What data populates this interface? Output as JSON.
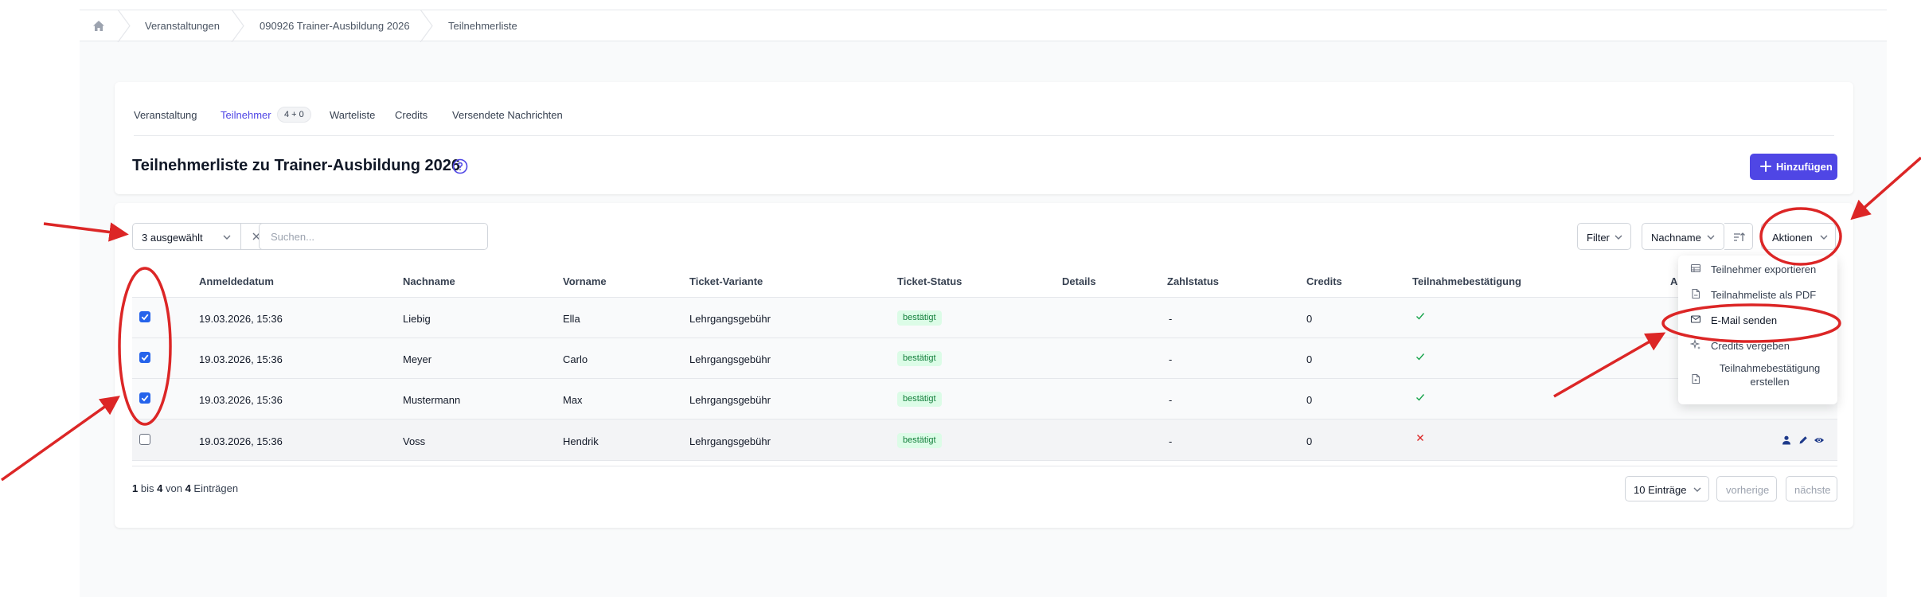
{
  "breadcrumb": {
    "items": [
      "Veranstaltungen",
      "090926 Trainer-Ausbildung 2026",
      "Teilnehmerliste"
    ]
  },
  "tabs": [
    {
      "label": "Veranstaltung"
    },
    {
      "label": "Teilnehmer",
      "badge": "4 + 0"
    },
    {
      "label": "Warteliste"
    },
    {
      "label": "Credits"
    },
    {
      "label": "Versendete Nachrichten"
    }
  ],
  "page": {
    "title": "Teilnehmerliste zu Trainer-Ausbildung 2026",
    "add_label": "Hinzufügen"
  },
  "toolbar": {
    "selection_label": "3 ausgewählt",
    "search_placeholder": "Suchen...",
    "filter_label": "Filter",
    "sort_label": "Nachname",
    "actions_label": "Aktionen"
  },
  "table": {
    "headers": [
      "Anmeldedatum",
      "Nachname",
      "Vorname",
      "Ticket-Variante",
      "Ticket-Status",
      "Details",
      "Zahlstatus",
      "Credits",
      "Teilnahmebestätigung",
      "A"
    ],
    "rows": [
      {
        "checked": true,
        "date": "19.03.2026, 15:36",
        "lastname": "Liebig",
        "firstname": "Ella",
        "ticket": "Lehrgangsgebühr",
        "status": "bestätigt",
        "zahlstatus": "-",
        "credits": "0",
        "confirmation": "check"
      },
      {
        "checked": true,
        "date": "19.03.2026, 15:36",
        "lastname": "Meyer",
        "firstname": "Carlo",
        "ticket": "Lehrgangsgebühr",
        "status": "bestätigt",
        "zahlstatus": "-",
        "credits": "0",
        "confirmation": "check"
      },
      {
        "checked": true,
        "date": "19.03.2026, 15:36",
        "lastname": "Mustermann",
        "firstname": "Max",
        "ticket": "Lehrgangsgebühr",
        "status": "bestätigt",
        "zahlstatus": "-",
        "credits": "0",
        "confirmation": "check"
      },
      {
        "checked": false,
        "date": "19.03.2026, 15:36",
        "lastname": "Voss",
        "firstname": "Hendrik",
        "ticket": "Lehrgangsgebühr",
        "status": "bestätigt",
        "zahlstatus": "-",
        "credits": "0",
        "confirmation": "cross"
      }
    ]
  },
  "pagination": {
    "from": "1",
    "bis": "bis",
    "to": "4",
    "von": "von",
    "total": "4",
    "eintraegen": "Einträgen",
    "per_page": "10 Einträge",
    "prev": "vorherige",
    "next": "nächste"
  },
  "actions_menu": {
    "items": [
      {
        "label": "Teilnehmer exportieren",
        "icon": "table-icon"
      },
      {
        "label": "Teilnahmeliste als PDF",
        "icon": "pdf-file-icon"
      },
      {
        "label": "E-Mail senden",
        "icon": "mail-icon"
      },
      {
        "label": "Credits vergeben",
        "icon": "sparkle-icon"
      },
      {
        "label": "Teilnahmebestätigung erstellen",
        "icon": "file-icon"
      }
    ]
  },
  "colors": {
    "accent": "#4f46e5",
    "annotation": "#dc2626",
    "success": "#16a34a",
    "danger": "#dc2626"
  }
}
